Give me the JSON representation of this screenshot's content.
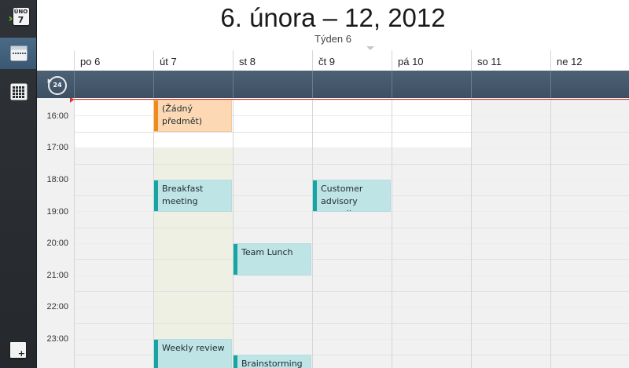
{
  "sidebar": {
    "today": {
      "month": "ÚNO",
      "day": "7"
    },
    "buttons": [
      {
        "name": "week-view-icon",
        "active": true
      },
      {
        "name": "month-view-icon",
        "active": false
      }
    ],
    "add_label": "+"
  },
  "header": {
    "title": "6. února – 12, 2012",
    "week": "Týden 6"
  },
  "days": [
    "po 6",
    "út 7",
    "st 8",
    "čt 9",
    "pá 10",
    "so 11",
    "ne 12"
  ],
  "allday": {
    "clock_label": "24"
  },
  "times": [
    "16:00",
    "17:00",
    "18:00",
    "19:00",
    "20:00",
    "21:00",
    "22:00",
    "23:00"
  ],
  "events": {
    "no_subject": {
      "line1": "(Žádný",
      "line2": "předmět)"
    },
    "breakfast": {
      "line1": "Breakfast",
      "line2": "meeting"
    },
    "customer": {
      "line1": "Customer",
      "line2": "advisory council"
    },
    "team_lunch": {
      "line1": "Team Lunch"
    },
    "weekly_review": {
      "line1": "Weekly review"
    },
    "brainstorming": {
      "line1": "Brainstorming"
    }
  },
  "colors": {
    "event_teal": "#1aa3a3",
    "event_orange": "#f18a1c",
    "current_time": "#e03030",
    "allday_bar": "#4d6175"
  }
}
